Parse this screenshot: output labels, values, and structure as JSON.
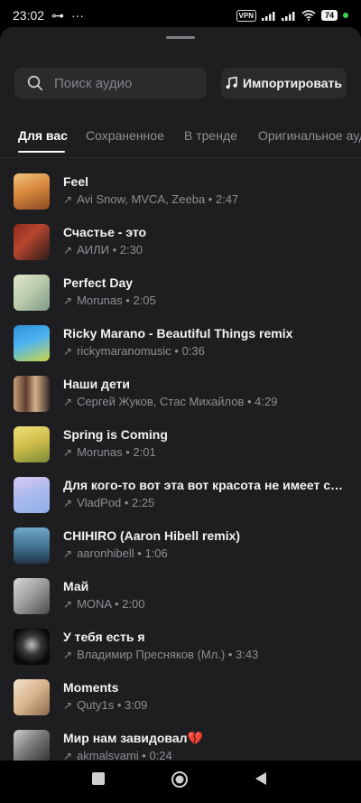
{
  "status": {
    "time": "23:02",
    "key": "⊶",
    "dots": "···",
    "vpn": "VPN",
    "battery": "74"
  },
  "search": {
    "placeholder": "Поиск аудио"
  },
  "import": {
    "label": "Импортировать"
  },
  "tabs": [
    {
      "label": "Для вас"
    },
    {
      "label": "Сохраненное"
    },
    {
      "label": "В тренде"
    },
    {
      "label": "Оригинальное аудио"
    }
  ],
  "tracks": [
    {
      "title": "Feel",
      "meta": "Avi Snow, MVCA, Zeeba • 2:47"
    },
    {
      "title": "Счастье - это",
      "meta": "АИЛИ • 2:30"
    },
    {
      "title": "Perfect Day",
      "meta": "Morunas • 2:05"
    },
    {
      "title": "Ricky Marano - Beautiful Things remix",
      "meta": "rickymaranomusic • 0:36"
    },
    {
      "title": "Наши дети",
      "meta": "Сергей Жуков, Стас Михайлов • 4:29"
    },
    {
      "title": "Spring is Coming",
      "meta": "Morunas • 2:01"
    },
    {
      "title": "Для кого-то вот эта вот красота не имеет см...",
      "meta": "VladPod • 2:25"
    },
    {
      "title": "CHIHIRO (Aaron Hibell remix)",
      "meta": "aaronhibell • 1:06"
    },
    {
      "title": "Май",
      "meta": "MONA • 2:00"
    },
    {
      "title": "У тебя есть я",
      "meta": "Владимир Пресняков (Мл.) • 3:43"
    },
    {
      "title": "Moments",
      "meta": "Quty1s • 3:09"
    },
    {
      "title": "Мир нам завидовал💔",
      "meta": "akmalsvami • 0:24"
    }
  ]
}
